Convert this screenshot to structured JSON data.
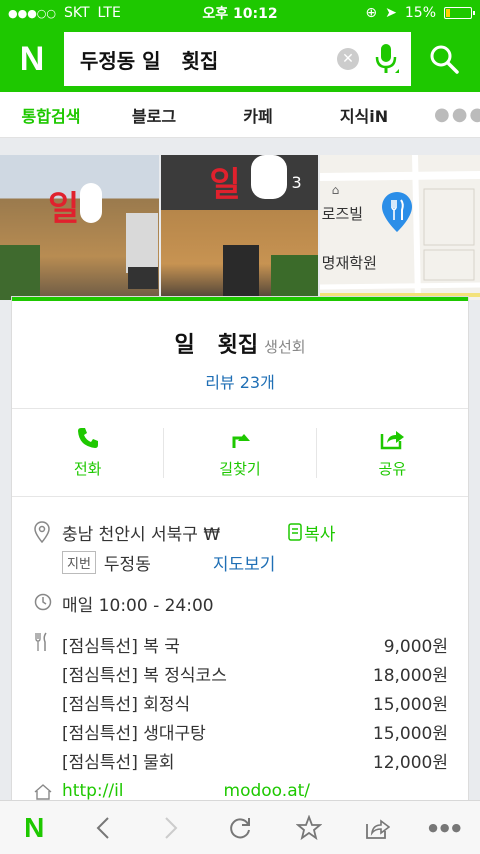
{
  "status_bar": {
    "signal": "●●●○○",
    "carrier": "SKT",
    "network": "LTE",
    "time": "오후 10:12",
    "battery": "15%",
    "battery_level": 0.15
  },
  "header": {
    "logo": "N",
    "query": "두정동 일   횟집",
    "accent_color": "#1ec800"
  },
  "tabs": [
    {
      "label": "통합검색",
      "active": true
    },
    {
      "label": "블로그"
    },
    {
      "label": "카페"
    },
    {
      "label": "지식iN"
    },
    {
      "label": "●●●"
    }
  ],
  "photos": {
    "photo1_sign": "일",
    "photo2_sign": "일",
    "photo_count": "3",
    "map_labels": [
      "로즈빌",
      "명재학원"
    ]
  },
  "place": {
    "name": "일   횟집",
    "category": "생선회",
    "review_label": "리뷰 23개",
    "actions": {
      "call": "전화",
      "directions": "길찾기",
      "share": "공유"
    },
    "address": "충남 천안시 서북구 ₩",
    "copy_label": "복사",
    "jibun_tag": "지번",
    "jibun_address": "두정동",
    "map_view": "지도보기",
    "hours": "매일 10:00 - 24:00",
    "menu": [
      {
        "name": "[점심특선] 복 국",
        "price": "9,000원"
      },
      {
        "name": "[점심특선] 복 정식코스",
        "price": "18,000원"
      },
      {
        "name": "[점심특선] 회정식",
        "price": "15,000원"
      },
      {
        "name": "[점심특선] 생대구탕",
        "price": "15,000원"
      },
      {
        "name": "[점심특선] 물회",
        "price": "12,000원"
      }
    ],
    "website_prefix": "http://il",
    "website_suffix": "modoo.at/"
  },
  "toolbar": {
    "logo": "N",
    "back": "‹",
    "forward": "›",
    "more": "●●●"
  }
}
